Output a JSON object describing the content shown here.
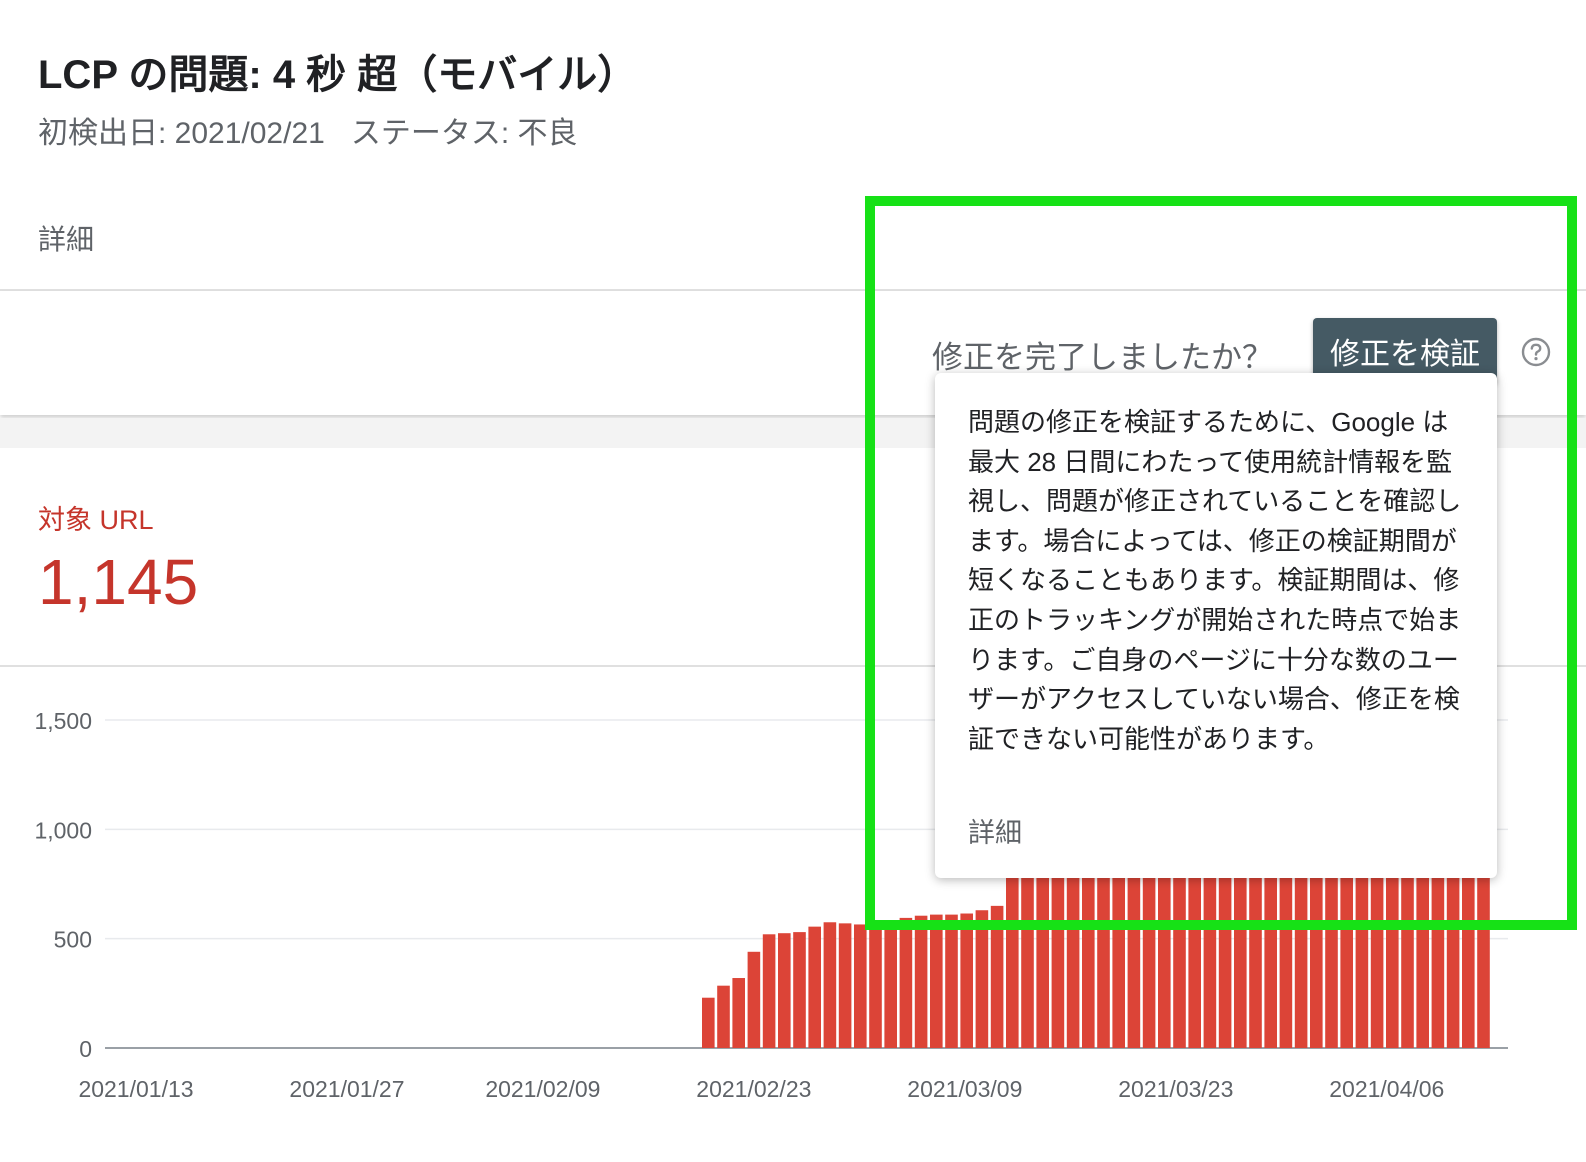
{
  "header": {
    "title": "LCP の問題: 4 秒 超（モバイル）",
    "first_detected": "初検出日: 2021/02/21",
    "status": "ステータス: 不良"
  },
  "tabs": {
    "details": "詳細"
  },
  "validation": {
    "prompt": "修正を完了しましたか？",
    "button_label": "修正を検証",
    "help_icon": "help-circle-icon"
  },
  "tooltip": {
    "text": "問題の修正を検証するために、Google は最大 28 日間にわたって使用統計情報を監視し、問題が修正されていることを確認します。場合によっては、修正の検証期間が短くなることもあります。検証期間は、修正のトラッキングが開始された時点で始まります。ご自身のページに十分な数のユーザーがアクセスしていない場合、修正を検証できない可能性があります。",
    "link_label": "詳細"
  },
  "metric": {
    "label": "対象 URL",
    "value": "1,145"
  },
  "colors": {
    "bar": "#dc4437",
    "metric": "#c5352b",
    "highlight": "#16e116",
    "button": "#455a64"
  },
  "chart_data": {
    "type": "bar",
    "x_tick_labels": [
      "2021/01/13",
      "2021/01/27",
      "2021/02/09",
      "2021/02/23",
      "2021/03/09",
      "2021/03/23",
      "2021/04/06"
    ],
    "y_ticks": [
      0,
      500,
      1000,
      1500
    ],
    "ylim": [
      0,
      1500
    ],
    "grid": true,
    "first_bar_date": "2021/02/21",
    "values": [
      230,
      285,
      320,
      440,
      520,
      525,
      530,
      555,
      575,
      570,
      565,
      570,
      580,
      595,
      605,
      610,
      610,
      615,
      630,
      650,
      1145,
      1145,
      1145,
      1145,
      1145,
      1145,
      1145,
      1145,
      1145,
      1145,
      1145,
      1145,
      1145,
      1145,
      1145,
      1145,
      1145,
      1145,
      1145,
      1145,
      1145,
      1145,
      1145,
      1145,
      1145,
      1145,
      1145,
      1145,
      1145,
      1145,
      1145,
      1145
    ]
  }
}
